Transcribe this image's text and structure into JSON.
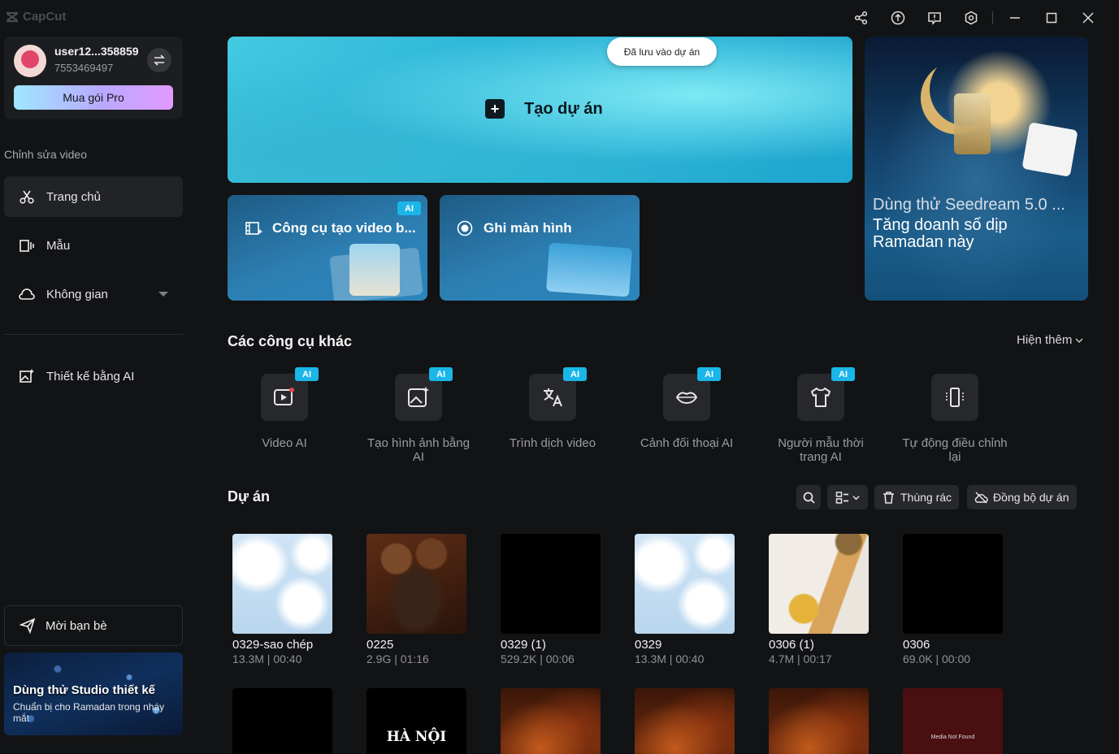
{
  "app": {
    "name": "CapCut"
  },
  "user": {
    "name": "user12...358859",
    "id": "7553469497",
    "pro_label": "Mua gói Pro"
  },
  "sidebar": {
    "section_label": "Chỉnh sửa video",
    "items": [
      {
        "label": "Trang chủ",
        "icon": "scissors-icon"
      },
      {
        "label": "Mẫu",
        "icon": "template-icon"
      },
      {
        "label": "Không gian",
        "icon": "cloud-icon"
      },
      {
        "label": "Thiết kế bằng AI",
        "icon": "ai-image-icon"
      }
    ],
    "invite_label": "Mời bạn bè",
    "promo": {
      "title": "Dùng thử Studio thiết kế",
      "subtitle": "Chuẩn bị cho Ramadan trong nháy mắt"
    }
  },
  "hero": {
    "create_label": "Tạo dự án",
    "saved_toast": "Đã lưu vào dự án",
    "cards": [
      {
        "label": "Công cụ tạo video b...",
        "badge": "AI"
      },
      {
        "label": "Ghi màn hình"
      }
    ],
    "promo": {
      "headline": "Dùng thử Seedream 5.0 ...",
      "text": "Tăng doanh số dịp Ramadan này"
    }
  },
  "other_tools": {
    "title": "Các công cụ khác",
    "more_label": "Hiện thêm",
    "items": [
      {
        "label": "Video AI",
        "badge": "AI"
      },
      {
        "label": "Tạo hình ảnh bằng AI",
        "badge": "AI"
      },
      {
        "label": "Trình dịch video",
        "badge": "AI"
      },
      {
        "label": "Cảnh đối thoại AI",
        "badge": "AI"
      },
      {
        "label": "Người mẫu thời trang AI",
        "badge": "AI"
      },
      {
        "label": "Tự động điều chỉnh lại"
      }
    ]
  },
  "projects": {
    "title": "Dự án",
    "trash_label": "Thùng rác",
    "sync_label": "Đồng bộ dự án",
    "row1": [
      {
        "name": "0329-sao chép",
        "meta": "13.3M | 00:40",
        "thumb": "sky"
      },
      {
        "name": "0225",
        "meta": "2.9G | 01:16",
        "thumb": "projector"
      },
      {
        "name": "0329 (1)",
        "meta": "529.2K | 00:06",
        "thumb": "black"
      },
      {
        "name": "0329",
        "meta": "13.3M | 00:40",
        "thumb": "sky"
      },
      {
        "name": "0306 (1)",
        "meta": "4.7M | 00:17",
        "thumb": "food"
      },
      {
        "name": "0306",
        "meta": "69.0K | 00:00",
        "thumb": "black"
      }
    ],
    "row2_captions": {
      "hanoi": "HÀ NỘI",
      "media_not_found": "Media Not Found"
    }
  }
}
